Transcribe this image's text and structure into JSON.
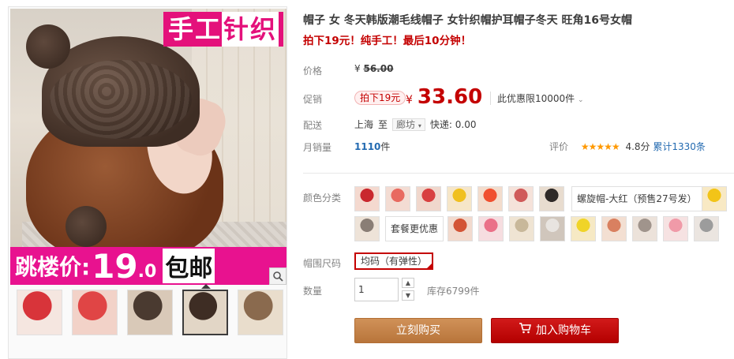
{
  "gallery": {
    "badge_a": "手工",
    "badge_b": "针织",
    "banner_prefix": "跳楼价:",
    "banner_price_int": "19",
    "banner_price_dec": ".0",
    "banner_suffix": "包邮",
    "thumbnails": [
      {
        "colors": [
          "#d8343a",
          "#f5e6e0"
        ]
      },
      {
        "colors": [
          "#e04545",
          "#f2d2c8"
        ]
      },
      {
        "colors": [
          "#4a3a30",
          "#d9c9b8"
        ]
      },
      {
        "colors": [
          "#3e2d24",
          "#e2d6c6"
        ],
        "active": true
      },
      {
        "colors": [
          "#8a6a4e",
          "#e9ddcc"
        ]
      }
    ]
  },
  "product": {
    "title": "帽子 女 冬天韩版潮毛线帽子 女针织帽护耳帽子冬天 旺角16号女帽",
    "subtitle": "拍下19元！纯手工！最后10分钟！",
    "price_label": "价格",
    "original_price_currency": "¥",
    "original_price": "56.00",
    "promo_label": "促销",
    "promo_tag": "拍下19元",
    "promo_price_currency": "¥",
    "promo_price": "33.60",
    "limit_text": "此优惠限10000件",
    "shipping_label": "配送",
    "ship_from": "上海",
    "ship_to_word": "至",
    "ship_to": "廊坊",
    "express_text": "快递: 0.00",
    "sales_label": "月销量",
    "sales_count": "1110",
    "sales_unit": "件",
    "rating_label": "评价",
    "rating_stars": "★★★★★",
    "rating_score": "4.8分",
    "rating_count": "累计1330条"
  },
  "sku": {
    "color_label": "颜色分类",
    "color_text_option": "螺旋帽-大红（预售27号发）",
    "bundle_text_option": "套餐更优惠",
    "swatches_row1": [
      {
        "c1": "#c9282e",
        "c2": "#f4d9cf"
      },
      {
        "c1": "#e86a60",
        "c2": "#f3dcd3"
      },
      {
        "c1": "#d84040",
        "c2": "#f0d7cc"
      },
      {
        "c1": "#f0c020",
        "c2": "#f6e6c8"
      },
      {
        "c1": "#f05030",
        "c2": "#f3dccc"
      },
      {
        "c1": "#d05a5a",
        "c2": "#f5e2da"
      },
      {
        "c1": "#2f2a28",
        "c2": "#e8dccf"
      }
    ],
    "swatch_row1_end": {
      "c1": "#f2c418",
      "c2": "#f8e9c4"
    },
    "swatches_row2_first": {
      "c1": "#8a7e76",
      "c2": "#eee3d8"
    },
    "swatches_row2": [
      {
        "c1": "#d35436",
        "c2": "#f2dace"
      },
      {
        "c1": "#ea7088",
        "c2": "#f6dde0"
      },
      {
        "c1": "#c8b89a",
        "c2": "#efe4d3"
      },
      {
        "c1": "#e8e4e0",
        "c2": "#d0c6bc"
      },
      {
        "c1": "#f0d428",
        "c2": "#f6e9c4"
      },
      {
        "c1": "#d98060",
        "c2": "#f3dfd2"
      },
      {
        "c1": "#a0948c",
        "c2": "#ece2da"
      },
      {
        "c1": "#f09aa8",
        "c2": "#f6e2e2"
      },
      {
        "c1": "#9c9c9c",
        "c2": "#ebe5e0"
      }
    ],
    "size_label": "帽围尺码",
    "size_option": "均码（有弹性）",
    "qty_label": "数量",
    "qty_value": "1",
    "stock_text": "库存6799件"
  },
  "actions": {
    "buy_now": "立刻购买",
    "add_to_cart": "加入购物车"
  },
  "colors": {
    "accent_red": "#c40000",
    "link_blue": "#246bb1",
    "buy_button": "#c7864b",
    "cart_button": "#c40000",
    "banner_pink": "#e8128f"
  }
}
